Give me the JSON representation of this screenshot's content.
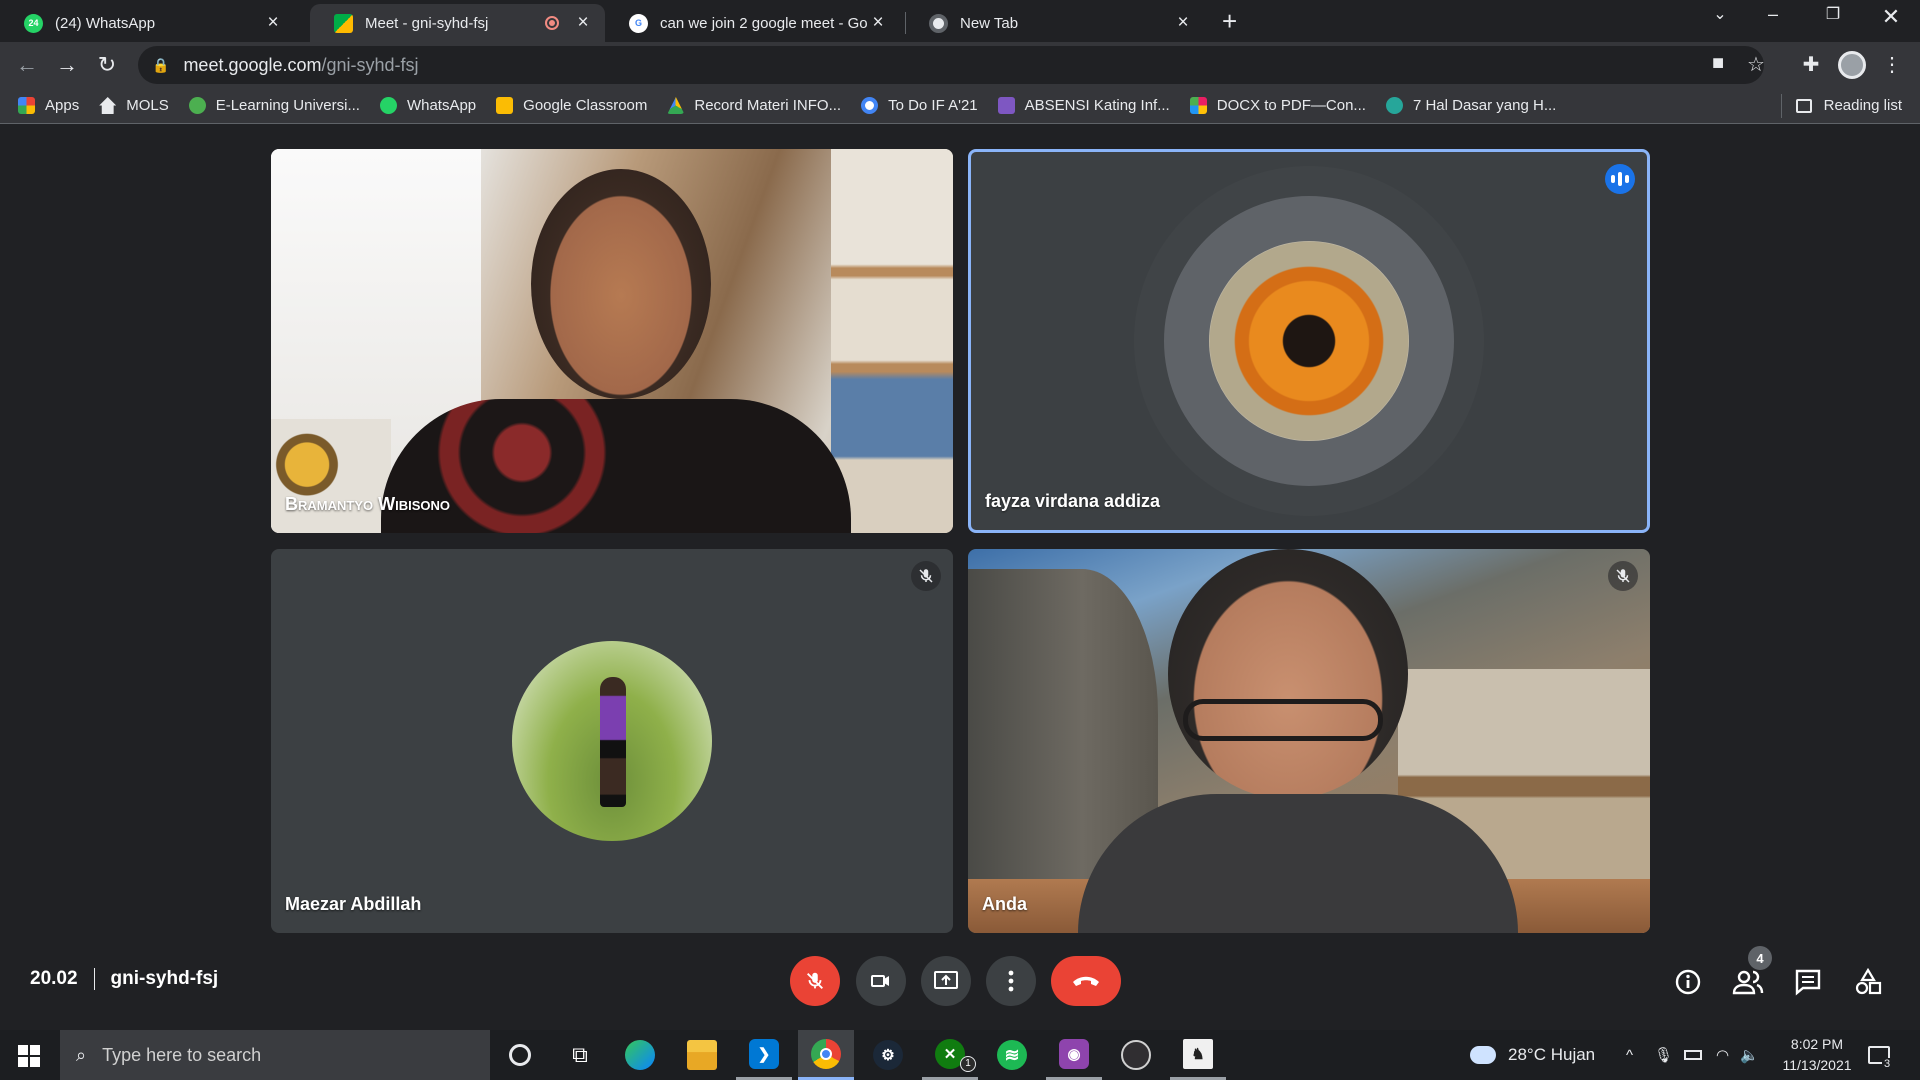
{
  "browser": {
    "tabs": [
      {
        "title": "(24) WhatsApp",
        "favicon_text": "24",
        "favicon_color": "#25d366"
      },
      {
        "title": "Meet - gni-syhd-fsj",
        "favicon_text": "",
        "favicon_color": "#00ac47"
      },
      {
        "title": "can we join 2 google meet - Goo",
        "favicon_text": "G",
        "favicon_color": "#4285f4"
      },
      {
        "title": "New Tab",
        "favicon_text": "",
        "favicon_color": "#9aa0a6"
      }
    ],
    "url_host": "meet.google.com",
    "url_path": "/gni-syhd-fsj",
    "bookmarks": [
      {
        "label": "Apps",
        "color": "#ea4335"
      },
      {
        "label": "MOLS",
        "color": "#e8eaed"
      },
      {
        "label": "E-Learning Universi...",
        "color": "#4caf50"
      },
      {
        "label": "WhatsApp",
        "color": "#25d366"
      },
      {
        "label": "Google Classroom",
        "color": "#fbbc04"
      },
      {
        "label": "Record Materi INFO...",
        "color": "#fbbc04"
      },
      {
        "label": "To Do IF A'21",
        "color": "#4285f4"
      },
      {
        "label": "ABSENSI Kating Inf...",
        "color": "#7e57c2"
      },
      {
        "label": "DOCX to PDF—Con...",
        "color": "#e91e63"
      },
      {
        "label": "7 Hal Dasar yang H...",
        "color": "#26a69a"
      }
    ],
    "reading_list": "Reading list"
  },
  "meet": {
    "participants": [
      {
        "name": "Bramantyo Wibisono",
        "camera": "on",
        "muted": false
      },
      {
        "name": "fayza virdana addiza",
        "camera": "off",
        "muted": false,
        "speaking": true
      },
      {
        "name": "Maezar Abdillah",
        "camera": "off",
        "muted": true
      },
      {
        "name": "Anda",
        "camera": "on",
        "muted": true
      }
    ],
    "time": "20.02",
    "meeting_code": "gni-syhd-fsj",
    "people_count": "4"
  },
  "taskbar": {
    "search_placeholder": "Type here to search",
    "weather": "28°C  Hujan",
    "time": "8:02 PM",
    "date": "11/13/2021",
    "notification_count": "3",
    "xbox_badge": "1"
  },
  "colors": {
    "accent_blue": "#8ab4f8",
    "end_call_red": "#ea4335",
    "speaking_blue": "#1a73e8"
  }
}
